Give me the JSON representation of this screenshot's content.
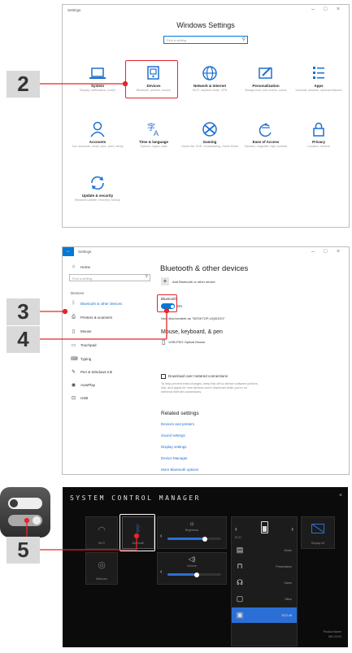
{
  "shot1": {
    "window_title": "Settings",
    "heading": "Windows Settings",
    "search_placeholder": "Find a setting",
    "tiles": [
      {
        "label": "System",
        "sub": "Display, notifications, power",
        "icon": "laptop-icon"
      },
      {
        "label": "Devices",
        "sub": "Bluetooth, printers, mouse",
        "icon": "devices-icon"
      },
      {
        "label": "Network & Internet",
        "sub": "Wi-Fi, airplane mode, VPN",
        "icon": "globe-icon"
      },
      {
        "label": "Personalization",
        "sub": "Background, lock screen, colors",
        "icon": "personalization-icon"
      },
      {
        "label": "Apps",
        "sub": "Uninstall, defaults, optional features",
        "icon": "apps-icon"
      },
      {
        "label": "Accounts",
        "sub": "Your accounts, email, sync, work, family",
        "icon": "person-icon"
      },
      {
        "label": "Time & language",
        "sub": "Speech, region, date",
        "icon": "time-language-icon"
      },
      {
        "label": "Gaming",
        "sub": "Game bar, DVR, broadcasting, Game Mode",
        "icon": "xbox-icon"
      },
      {
        "label": "Ease of Access",
        "sub": "Narrator, magnifier, high contrast",
        "icon": "ease-of-access-icon"
      },
      {
        "label": "Privacy",
        "sub": "Location, camera",
        "icon": "lock-icon"
      },
      {
        "label": "Update & security",
        "sub": "Windows Update, recovery, backup",
        "icon": "update-icon"
      }
    ]
  },
  "shot2": {
    "window_title": "Settings",
    "home": "Home",
    "search_placeholder": "Find a setting",
    "section": "Devices",
    "nav": [
      {
        "label": "Bluetooth & other devices",
        "icon": "bluetooth-icon"
      },
      {
        "label": "Printers & scanners",
        "icon": "printer-icon"
      },
      {
        "label": "Mouse",
        "icon": "mouse-icon"
      },
      {
        "label": "Touchpad",
        "icon": "touchpad-icon"
      },
      {
        "label": "Typing",
        "icon": "keyboard-icon"
      },
      {
        "label": "Pen & Windows Ink",
        "icon": "pen-icon"
      },
      {
        "label": "AutoPlay",
        "icon": "autoplay-icon"
      },
      {
        "label": "USB",
        "icon": "usb-icon"
      }
    ],
    "title": "Bluetooth & other devices",
    "add_device": "Add Bluetooth or other device",
    "bt_label": "Bluetooth",
    "bt_state": "On",
    "discoverable": "Now discoverable as \"DESKTOP-UQ0IJOO\"",
    "mouse_section": "Mouse, keyboard, & pen",
    "mouse_device": "USB-PS/2 Optical Mouse",
    "metered_label": "Download over metered connections",
    "metered_desc": "To help prevent extra charges, keep this off so device software (drivers, info, and apps) for new devices won't download while you're on metered Internet connections.",
    "related": "Related settings",
    "links": [
      "Devices and printers",
      "Sound settings",
      "Display settings",
      "Device Manager",
      "More Bluetooth options"
    ]
  },
  "shot3": {
    "title": "SYSTEM CONTROL MANAGER",
    "tiles": [
      {
        "label": "Wi-Fi",
        "icon": "wifi-icon"
      },
      {
        "label": "Bluetooth",
        "icon": "bluetooth-icon"
      },
      {
        "label": "Webcam",
        "icon": "webcam-icon"
      }
    ],
    "brightness": "Brightness",
    "brightness_level": 0.7,
    "volume": "Volume",
    "volume_level": 0.55,
    "eco": "ECO",
    "modes": [
      {
        "label": "Movie",
        "icon": "movie-icon"
      },
      {
        "label": "Presentation",
        "icon": "presentation-icon"
      },
      {
        "label": "Game",
        "icon": "game-icon"
      },
      {
        "label": "Office",
        "icon": "office-icon"
      },
      {
        "label": "ECO off",
        "icon": "eco-icon"
      }
    ],
    "display_off": "Display off",
    "product_name": "Product Name",
    "model": "MS-XXXX"
  },
  "steps": [
    "2",
    "3",
    "4",
    "5"
  ],
  "colors": {
    "callout_red": "#e3262b",
    "accent_blue": "#2b6fd6",
    "win_blue": "#0078d7"
  }
}
